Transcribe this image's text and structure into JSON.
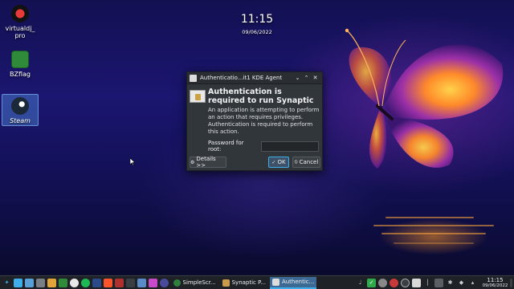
{
  "desktop": {
    "icons": [
      {
        "label_line1": "virtualdj_",
        "label_line2": "pro"
      },
      {
        "label_line1": "BZflag",
        "label_line2": ""
      },
      {
        "label_line1": "Steam",
        "label_line2": ""
      }
    ],
    "clock_time": "11:15",
    "clock_date": "09/06/2022"
  },
  "dialog": {
    "title": "Authenticatio...it1 KDE Agent",
    "heading": "Authentication is required to run Synaptic",
    "description": "An application is attempting to perform an action that requires privileges. Authentication is required to perform this action.",
    "password_label": "Password for root:",
    "password_value": "",
    "details_button": "Details >>",
    "ok_button": "OK",
    "cancel_button": "Cancel",
    "titlebar_icons": [
      "chevron-down-icon",
      "chevron-up-icon",
      "close-icon"
    ]
  },
  "taskbar": {
    "tasks": [
      {
        "label": "SimpleScr...",
        "icon": "simplescreenrecorder-icon"
      },
      {
        "label": "Synaptic P...",
        "icon": "synaptic-icon"
      },
      {
        "label": "Authentic...",
        "icon": "auth-icon"
      }
    ],
    "clock_time": "11:15",
    "clock_date": "09/06/2022"
  },
  "colors": {
    "accent": "#3daee9",
    "dialog_bg": "#31363b",
    "taskbar_bg": "#1e2227"
  }
}
